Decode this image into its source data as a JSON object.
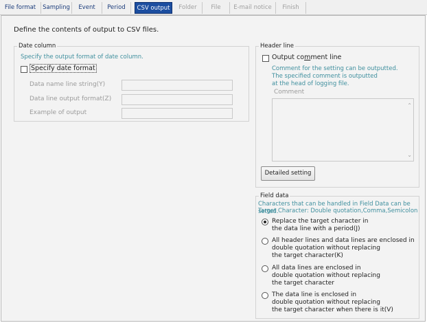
{
  "tabs": [
    {
      "label": "File format",
      "state": "normal"
    },
    {
      "label": "Sampling",
      "state": "normal"
    },
    {
      "label": "Event",
      "state": "normal"
    },
    {
      "label": "Period",
      "state": "normal"
    },
    {
      "label": "CSV output",
      "state": "active"
    },
    {
      "label": "Folder",
      "state": "disabled"
    },
    {
      "label": "File",
      "state": "disabled"
    },
    {
      "label": "E-mail notice",
      "state": "disabled"
    },
    {
      "label": "Finish",
      "state": "disabled"
    }
  ],
  "intro": "Define the contents of output to CSV files.",
  "date_column": {
    "title": "Date column",
    "hint": "Specify the output format of date column.",
    "specify_label": "Specify date format",
    "specify_checked": false,
    "name_line_label": "Data name line string(Y)",
    "line_format_label": "Data line output format(Z)",
    "example_label": "Example of output",
    "name_line_value": "",
    "line_format_value": "",
    "example_value": ""
  },
  "header_line": {
    "title": "Header line",
    "output_comment_label_pre": "Output co",
    "output_comment_label_key": "m",
    "output_comment_label_post": "ment line",
    "output_comment_checked": false,
    "hint_1": "Comment for the setting can be outputted.",
    "hint_2": "The specified comment is outputted",
    "hint_3": "at the head of logging file.",
    "comment_label": "Comment",
    "comment_value": "",
    "detailed_button": "Detailed setting"
  },
  "field_data": {
    "title": "Field data",
    "hint_1": "Characters that can be handled in Field Data can be setted.",
    "hint_2": "Target Character: Double quotation,Comma,Semicolon",
    "options": [
      {
        "lines": [
          "Replace the target character in",
          "the data line with a period(J)"
        ],
        "selected": true
      },
      {
        "lines": [
          "All header lines and data lines are enclosed in",
          "double quotation without replacing",
          "the target character(K)"
        ],
        "selected": false
      },
      {
        "lines": [
          "All data lines are enclosed in",
          "double quotation without replacing",
          "the target character"
        ],
        "selected": false
      },
      {
        "lines": [
          "The data line is enclosed in",
          "double quotation without replacing",
          "the target character when there is it(V)"
        ],
        "selected": false
      }
    ]
  }
}
